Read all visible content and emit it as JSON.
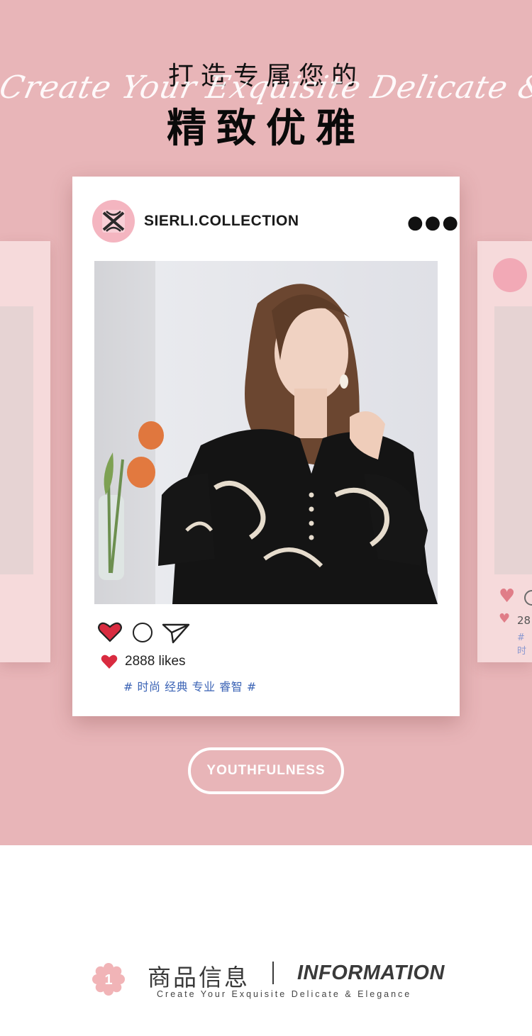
{
  "header": {
    "headline_line1": "打造专属您的",
    "headline_line2": "精致优雅",
    "script_text": "Create Your Exquisite Delicate & Elegance"
  },
  "post": {
    "account_name": "SIERLI.COLLECTION",
    "more_icon": "more-dots-icon",
    "likes_text": "2888 likes",
    "hashtags": "# 时尚 经典 专业 睿智 #",
    "actions": [
      "heart-icon",
      "comment-icon",
      "share-icon"
    ]
  },
  "side_card": {
    "likes_partial": "28",
    "tag_partial": "# 时"
  },
  "cta": {
    "label": "YOUTHFULNESS"
  },
  "info": {
    "badge_number": "1",
    "title_cn": "商品信息",
    "title_en": "INFORMATION",
    "subtitle": "Create Your Exquisite Delicate & Elegance"
  },
  "colors": {
    "hero_background": "#e8b5b8",
    "heart_red": "#d92b40",
    "hashtag_blue": "#3b63b5",
    "avatar_pink": "#f4b5c0"
  }
}
